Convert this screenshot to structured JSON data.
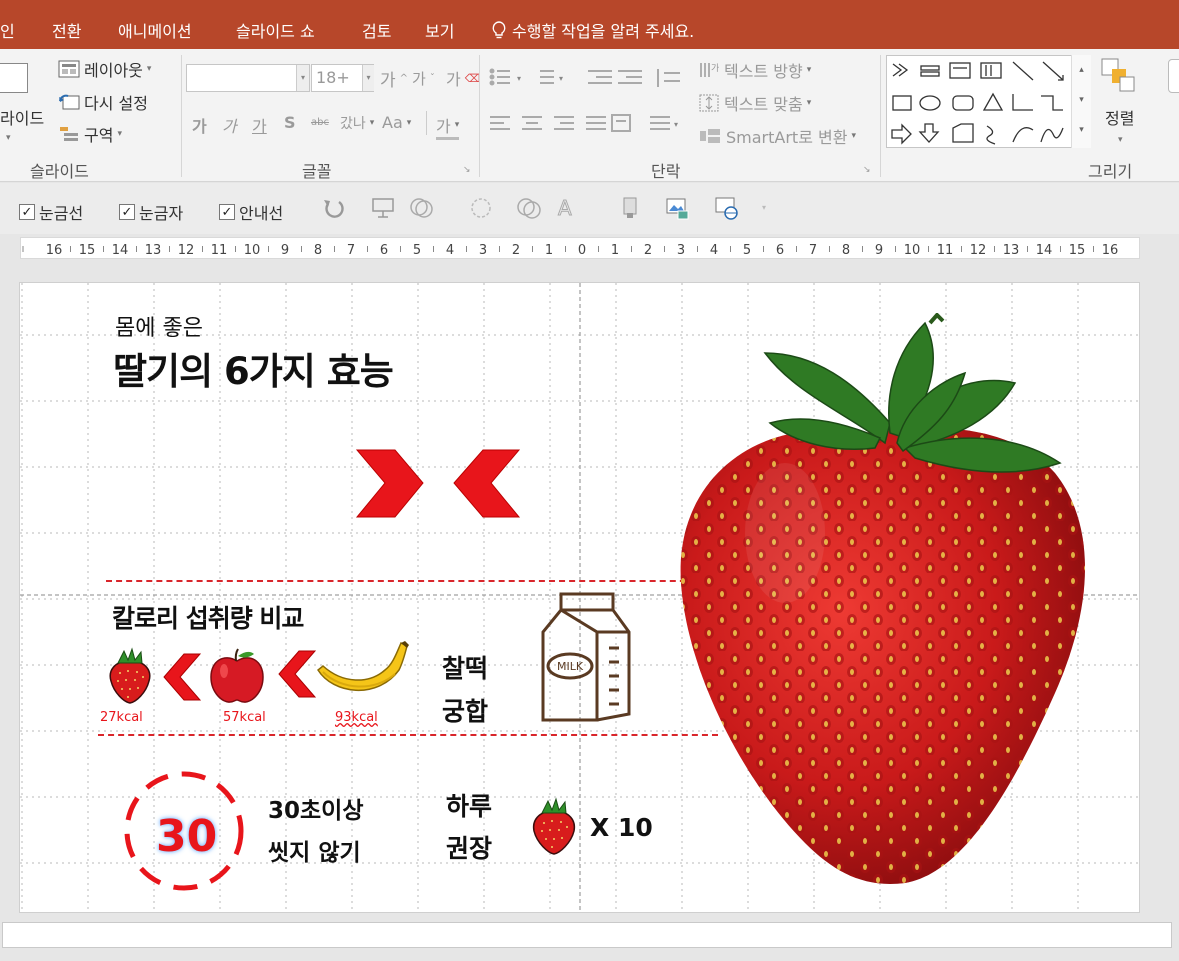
{
  "menu": {
    "tabs": [
      "인",
      "전환",
      "애니메이션",
      "슬라이드 쇼",
      "검토",
      "보기"
    ],
    "tell_me": "수행할 작업을 알려 주세요."
  },
  "ribbon": {
    "slides": {
      "label": "슬라이드",
      "new_slide": "라이드",
      "layout": "레이아웃",
      "reset": "다시 설정",
      "section": "구역"
    },
    "font": {
      "label": "글꼴",
      "size": "18+",
      "grow": "가",
      "shrink": "가",
      "clear": "가",
      "bold": "가",
      "italic": "가",
      "underline": "가",
      "shadow": "S",
      "strike": "abc",
      "spacing": "갔나",
      "case": "Aa",
      "color": "가"
    },
    "paragraph": {
      "label": "단락",
      "text_direction": "텍스트 방향",
      "align_text": "텍스트 맞춤",
      "smartart": "SmartArt로 변환"
    },
    "drawing": {
      "label": "그리기",
      "arrange": "정렬"
    }
  },
  "view": {
    "gridlines": "눈금선",
    "ruler": "눈금자",
    "guides": "안내선"
  },
  "ruler_numbers": [
    "16",
    "15",
    "14",
    "13",
    "12",
    "11",
    "10",
    "9",
    "8",
    "7",
    "6",
    "5",
    "4",
    "3",
    "2",
    "1",
    "0",
    "1",
    "2",
    "3",
    "4",
    "5",
    "6",
    "7",
    "8",
    "9",
    "10",
    "11",
    "12",
    "13",
    "14",
    "15",
    "16"
  ],
  "slide": {
    "subtitle": "몸에 좋은",
    "title": "딸기의 6가지 효능",
    "calorie_title": "칼로리 섭취량 비교",
    "kcal": [
      "27kcal",
      "57kcal",
      "93kcal"
    ],
    "combo": [
      "찰떡",
      "궁합"
    ],
    "milk_label": "MILK",
    "wash_number": "30",
    "wash": [
      "30초이상",
      "씻지 않기"
    ],
    "daily": [
      "하루",
      "권장"
    ],
    "times": "X 10"
  },
  "colors": {
    "accent": "#b7472a",
    "slide_red": "#e8151b",
    "dash_red": "#d9262b"
  }
}
